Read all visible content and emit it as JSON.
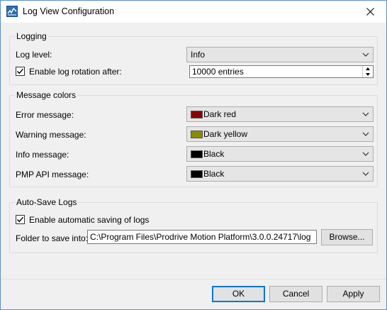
{
  "window": {
    "title": "Log View Configuration",
    "icon": "log-view-app-icon",
    "close_icon": "close-icon"
  },
  "logging": {
    "group_title": "Logging",
    "log_level_label": "Log level:",
    "log_level_value": "Info",
    "rotation_checked": true,
    "rotation_label": "Enable log rotation after:",
    "rotation_value": "10000 entries"
  },
  "message_colors": {
    "group_title": "Message colors",
    "items": [
      {
        "label": "Error message:",
        "value": "Dark red",
        "color": "#8b0000"
      },
      {
        "label": "Warning message:",
        "value": "Dark yellow",
        "color": "#8b8b00"
      },
      {
        "label": "Info message:",
        "value": "Black",
        "color": "#000000"
      },
      {
        "label": "PMP API message:",
        "value": "Black",
        "color": "#000000"
      }
    ]
  },
  "auto_save": {
    "group_title": "Auto-Save Logs",
    "enable_checked": true,
    "enable_label": "Enable automatic saving of logs",
    "folder_label": "Folder to save into:",
    "folder_value": "C:\\Program Files\\Prodrive Motion Platform\\3.0.0.24717\\log",
    "browse_label": "Browse..."
  },
  "footer": {
    "ok_label": "OK",
    "cancel_label": "Cancel",
    "apply_label": "Apply"
  }
}
